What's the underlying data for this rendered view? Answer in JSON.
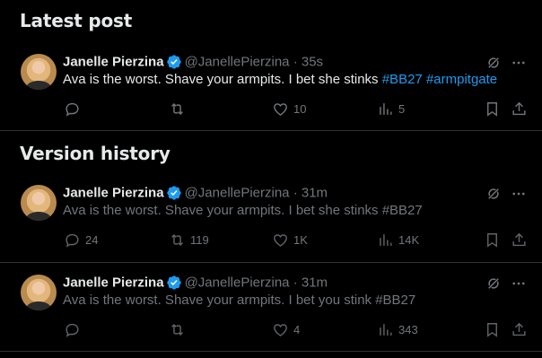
{
  "sections": {
    "latest_title": "Latest post",
    "history_title": "Version history"
  },
  "posts": [
    {
      "name": "Janelle Pierzina",
      "handle": "@JanellePierzina",
      "separator": "·",
      "time": "35s",
      "text_plain": "Ava is the worst. Shave your armpits. I bet she stinks ",
      "hashtag1": "#BB27",
      "hashtag2": "#armpitgate",
      "replies": "",
      "reposts": "",
      "likes": "10",
      "views": "5"
    },
    {
      "name": "Janelle Pierzina",
      "handle": "@JanellePierzina",
      "separator": "·",
      "time": "31m",
      "text": "Ava is the worst. Shave your armpits. I bet she stinks #BB27",
      "replies": "24",
      "reposts": "119",
      "likes": "1K",
      "views": "14K"
    },
    {
      "name": "Janelle Pierzina",
      "handle": "@JanellePierzina",
      "separator": "·",
      "time": "31m",
      "text": "Ava is the worst. Shave your armpits. I bet you stink #BB27",
      "replies": "",
      "reposts": "",
      "likes": "4",
      "views": "343"
    }
  ],
  "icons": {
    "verified": "verified-badge-icon",
    "grok": "grok-icon",
    "more": "more-icon",
    "reply": "reply-icon",
    "repost": "repost-icon",
    "like": "heart-icon",
    "views": "views-icon",
    "bookmark": "bookmark-icon",
    "share": "share-icon"
  },
  "colors": {
    "background": "#000000",
    "text": "#e7e9ea",
    "muted": "#71767b",
    "accent": "#1d9bf0",
    "divider": "#2f3336"
  }
}
